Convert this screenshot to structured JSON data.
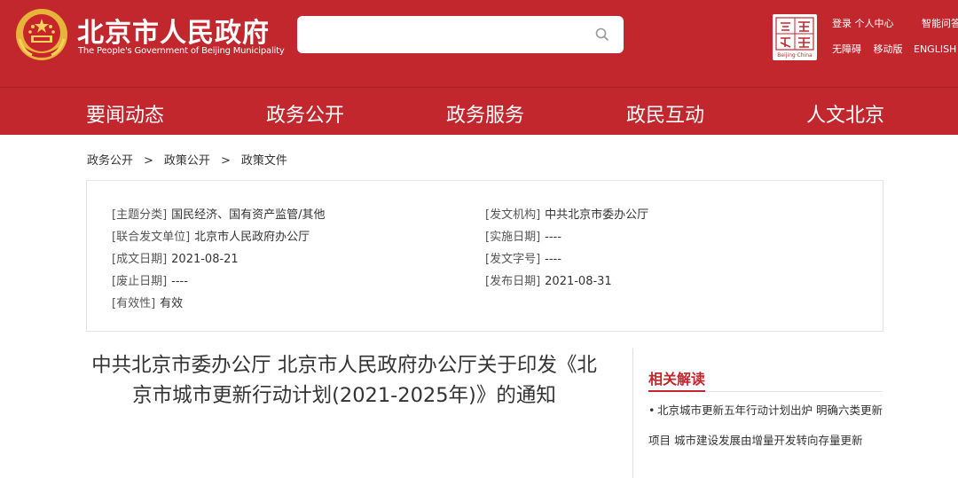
{
  "header": {
    "site_title": "北京市人民政府",
    "site_subtitle": "The People's Government of Beijing Municipality",
    "search": {
      "value": "",
      "placeholder": ""
    },
    "capital_logo": {
      "icon": "capital-beijing-china-logo",
      "sub_text": "Beijing·China"
    },
    "links": {
      "login": "登录",
      "personal_center": "个人中心",
      "smart_qa": "智能问答",
      "accessibility": "无障碍",
      "mobile": "移动版",
      "english": "ENGLISH"
    },
    "colors": {
      "primary": "#c1272d"
    }
  },
  "nav": {
    "items": [
      {
        "label": "要闻动态"
      },
      {
        "label": "政务公开"
      },
      {
        "label": "政务服务"
      },
      {
        "label": "政民互动"
      },
      {
        "label": "人文北京"
      }
    ]
  },
  "breadcrumb": {
    "items": [
      "政务公开",
      "政策公开",
      "政策文件"
    ],
    "separator": ">"
  },
  "info": {
    "topic": {
      "key": "[主题分类]",
      "value": "国民经济、国有资产监管/其他"
    },
    "joint_issuer": {
      "key": "[联合发文单位]",
      "value": "北京市人民政府办公厅"
    },
    "written_date": {
      "key": "[成文日期]",
      "value": "2021-08-21"
    },
    "expiry_date": {
      "key": "[废止日期]",
      "value": "----"
    },
    "validity": {
      "key": "[有效性]",
      "value": "有效"
    },
    "issuer": {
      "key": "[发文机构]",
      "value": "中共北京市委办公厅"
    },
    "effective_date": {
      "key": "[实施日期]",
      "value": "----"
    },
    "doc_number": {
      "key": "[发文字号]",
      "value": "----"
    },
    "publish_date": {
      "key": "[发布日期]",
      "value": "2021-08-31"
    }
  },
  "article": {
    "title": "中共北京市委办公厅 北京市人民政府办公厅关于印发《北京市城市更新行动计划(2021-2025年)》的通知"
  },
  "related": {
    "heading": "相关解读",
    "items": [
      {
        "text": "北京城市更新五年行动计划出炉 明确六类更新项目 城市建设发展由增量开发转向存量更新"
      }
    ]
  }
}
